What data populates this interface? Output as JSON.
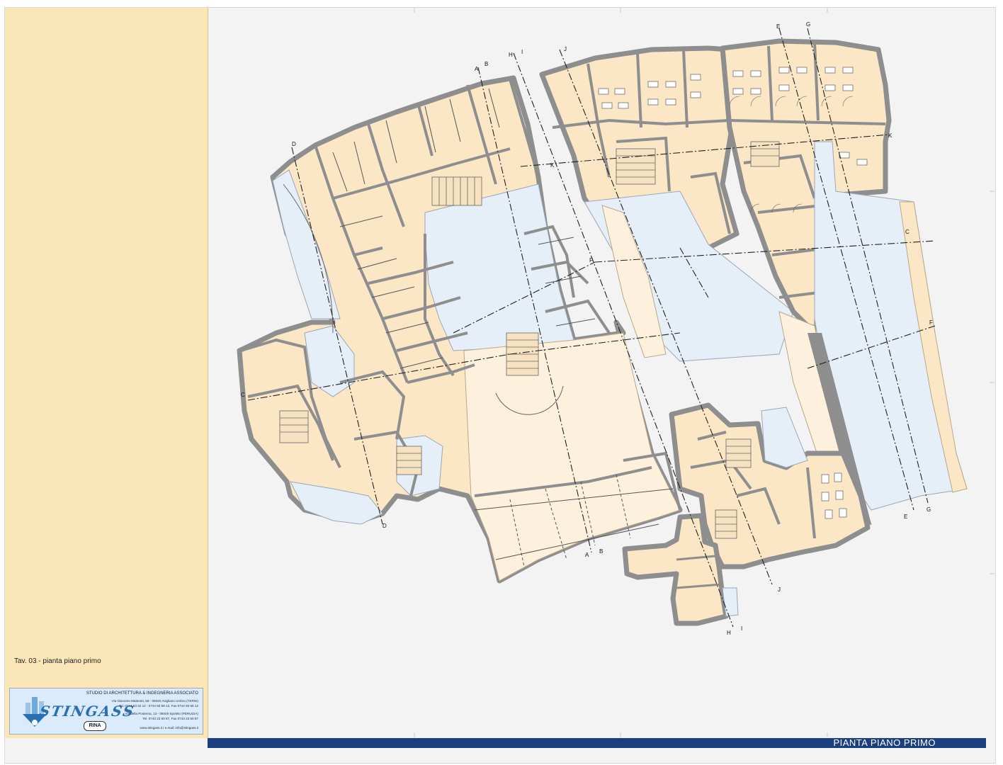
{
  "sheet": {
    "label": "Tav. 03 - pianta piano primo",
    "title": "PIANTA PIANO PRIMO"
  },
  "company": {
    "name": "STINGASS",
    "studio": "STUDIO DI ARCHITETTURA & INGEGNERIA ASSOCIATO",
    "address_1": "Via Giacomo Matteotti, 58 - 05020 Avigliano Umbro (TERNI)",
    "phone_1": "Tel. 0744 93 32 12 - 0744 93 58 12, Fax 0744 93 58 12",
    "address_2": "Via della Posterna, 13 - 06049 Spoleto (PERUGIA)",
    "phone_2": "Tel. 0743 23 50 87, Fax 0743 23 50 87",
    "web": "www.stingass.it / e.mail: info@stingass.it",
    "cert": "RINA"
  },
  "section_markers": [
    "A",
    "B",
    "C",
    "D",
    "E",
    "F",
    "G",
    "H",
    "I",
    "J",
    "K"
  ],
  "colors": {
    "wall": "#8e8e8e",
    "room_fill": "#fbe6c6",
    "open_fill": "#e6eef8",
    "courtyard": "#fdf1dd",
    "bar": "#1b3f7e",
    "panel": "#fbe6b8"
  }
}
